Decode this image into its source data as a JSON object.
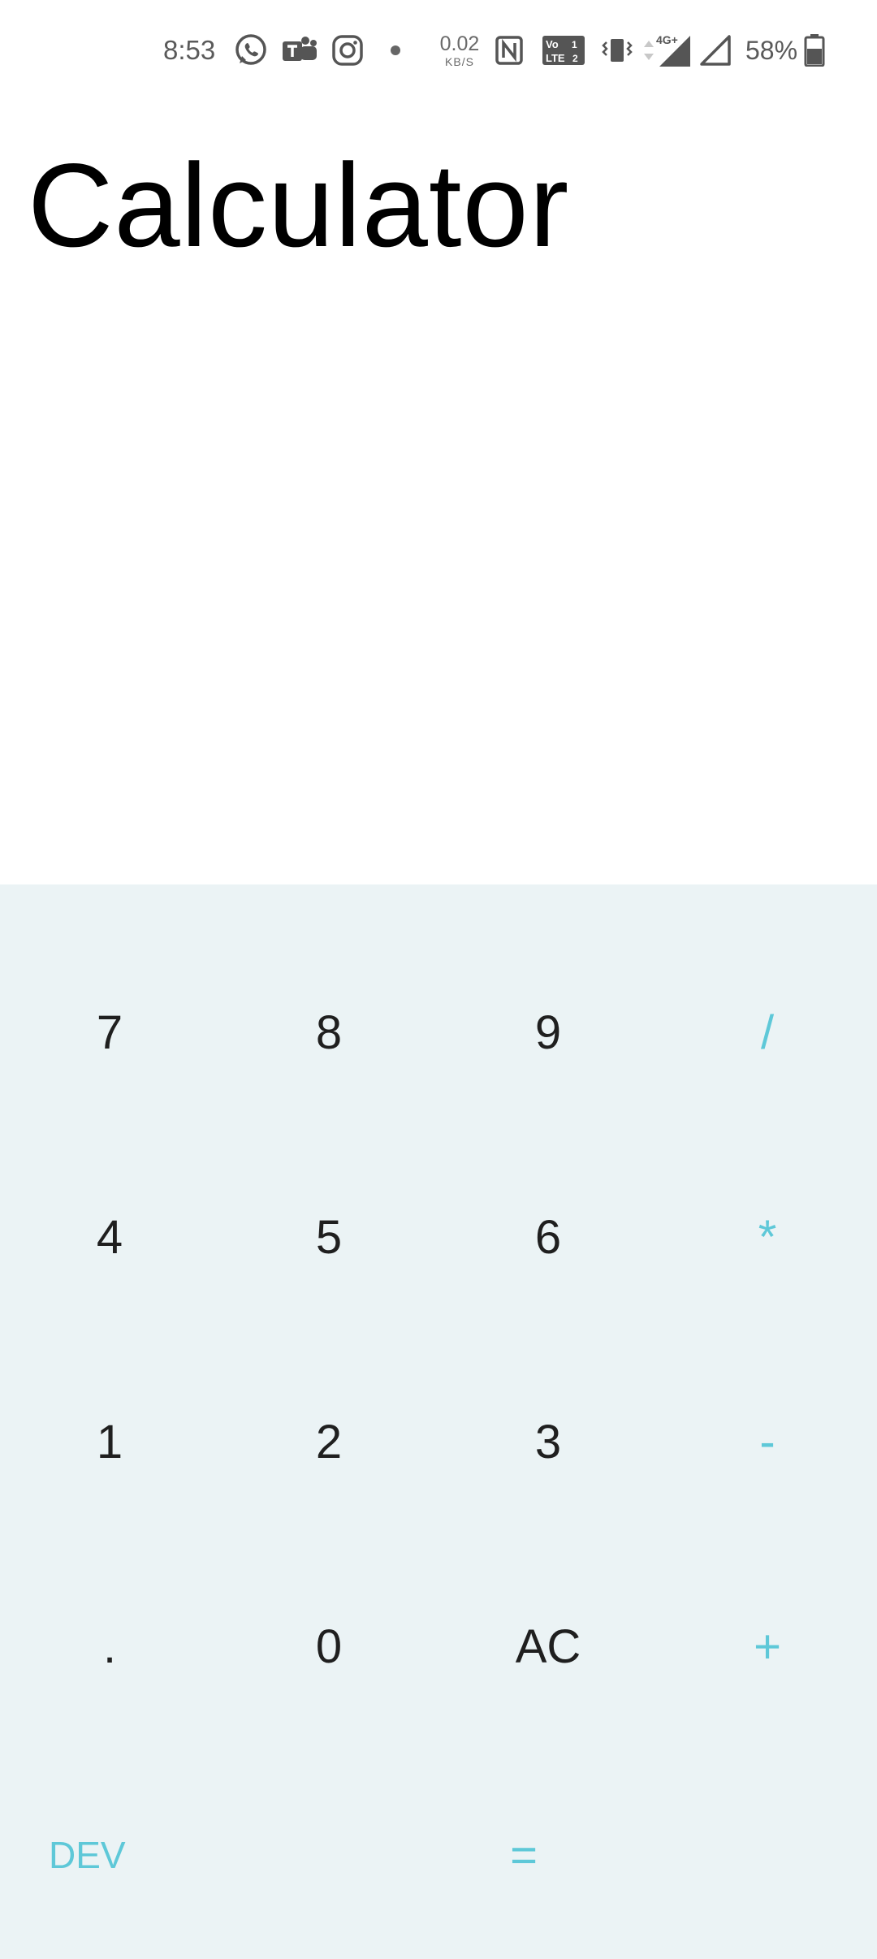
{
  "status_bar": {
    "time": "8:53",
    "net_speed_value": "0.02",
    "net_speed_unit": "KB/S",
    "network_label": "4G+",
    "battery_percent": "58%",
    "icons": [
      "whatsapp-icon",
      "teams-icon",
      "instagram-icon",
      "dot-icon",
      "nfc-icon",
      "volte-icon",
      "vibrate-icon",
      "data-arrows-icon",
      "signal-icon",
      "signal-icon-2",
      "battery-icon"
    ]
  },
  "app": {
    "title": "Calculator"
  },
  "keypad": {
    "rows": [
      [
        "7",
        "8",
        "9",
        "/"
      ],
      [
        "4",
        "5",
        "6",
        "*"
      ],
      [
        "1",
        "2",
        "3",
        "-"
      ],
      [
        ".",
        "0",
        "AC",
        "+"
      ]
    ],
    "dev_label": "DEV",
    "equals_label": "=",
    "accent_color": "#5ec8d8",
    "background_color": "#ebf3f5",
    "digit_color": "#1f1f1f"
  }
}
